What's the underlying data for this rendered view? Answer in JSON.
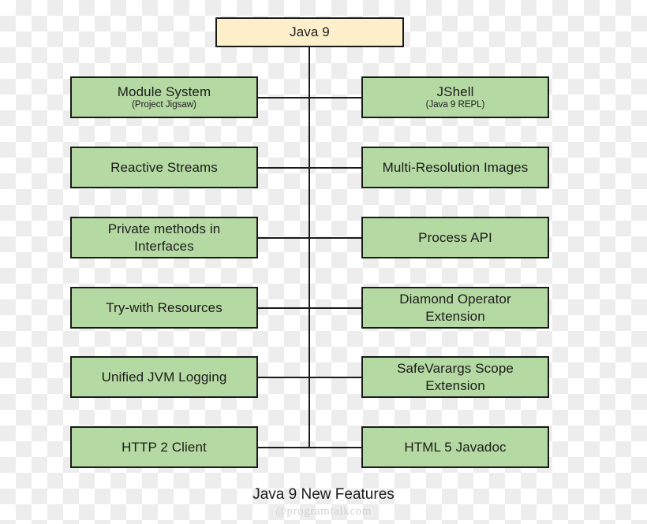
{
  "diagram": {
    "caption": "Java 9 New Features",
    "watermark": "@programtalkcom",
    "colors": {
      "root_fill": "#fcefca",
      "feature_fill": "#b5d9a2",
      "border": "#1a1a1a",
      "text": "#1c1c1c",
      "checker_gray": "#ededed",
      "watermark_text": "#d2d2d2"
    },
    "root": {
      "title": "Java 9"
    },
    "rows": [
      {
        "left": {
          "title": "Module System",
          "subtitle": "(Project Jigsaw)"
        },
        "right": {
          "title": "JShell",
          "subtitle": "(Java 9 REPL)"
        }
      },
      {
        "left": {
          "title": "Reactive Streams",
          "subtitle": ""
        },
        "right": {
          "title": "Multi-Resolution Images",
          "subtitle": ""
        }
      },
      {
        "left": {
          "title": "Private methods in Interfaces",
          "subtitle": ""
        },
        "right": {
          "title": "Process API",
          "subtitle": ""
        }
      },
      {
        "left": {
          "title": "Try-with Resources",
          "subtitle": ""
        },
        "right": {
          "title": "Diamond Operator Extension",
          "subtitle": ""
        }
      },
      {
        "left": {
          "title": "Unified JVM Logging",
          "subtitle": ""
        },
        "right": {
          "title": "SafeVarargs Scope Extension",
          "subtitle": ""
        }
      },
      {
        "left": {
          "title": "HTTP 2 Client",
          "subtitle": ""
        },
        "right": {
          "title": "HTML 5 Javadoc",
          "subtitle": ""
        }
      }
    ]
  }
}
